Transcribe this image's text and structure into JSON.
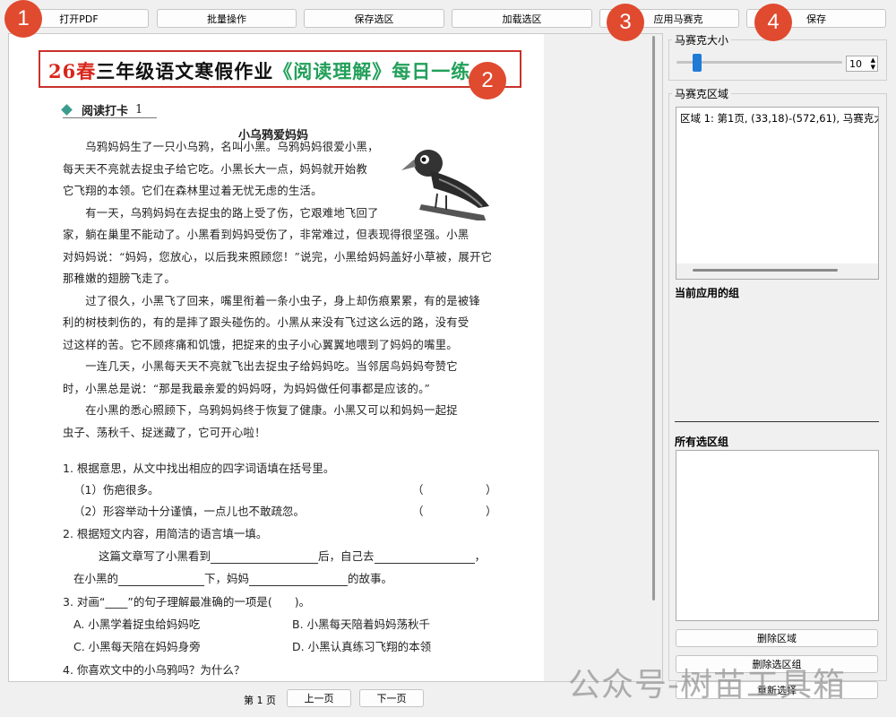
{
  "toolbar": {
    "open_pdf": "打开PDF",
    "batch": "批量操作",
    "save_selection": "保存选区",
    "load_selection": "加载选区",
    "apply_mosaic": "应用马赛克",
    "save": "保存"
  },
  "badges": [
    "1",
    "2",
    "3",
    "4"
  ],
  "document": {
    "title_red": "26春",
    "title_black": "三年级语文寒假作业",
    "title_green": "《阅读理解》每日一练",
    "section": "阅读打卡",
    "section_no": "1",
    "story_title": "小乌鸦爱妈妈",
    "paragraphs": [
      "　　乌鸦妈妈生了一只小乌鸦，名叫小黑。乌鸦妈妈很爱小黑，",
      "每天天不亮就去捉虫子给它吃。小黑长大一点，妈妈就开始教",
      "它飞翔的本领。它们在森林里过着无忧无虑的生活。",
      "　　有一天，乌鸦妈妈在去捉虫的路上受了伤，它艰难地飞回了",
      "家，躺在巢里不能动了。小黑看到妈妈受伤了，非常难过，但表现得很坚强。小黑",
      "对妈妈说：“妈妈，您放心，以后我来照顾您！”说完，小黑给妈妈盖好小草被，展开它",
      "那稚嫩的翅膀飞走了。",
      "　　过了很久，小黑飞了回来，嘴里衔着一条小虫子，身上却伤痕累累，有的是被锋",
      "利的树枝刺伤的，有的是摔了跟头碰伤的。小黑从来没有飞过这么远的路，没有受",
      "过这样的苦。它不顾疼痛和饥饿，把捉来的虫子小心翼翼地喂到了妈妈的嘴里。",
      "　　一连几天，小黑每天天不亮就飞出去捉虫子给妈妈吃。当邻居鸟妈妈夸赞它",
      "时，小黑总是说：“那是我最亲爱的妈妈呀，为妈妈做任何事都是应该的。”",
      "　　在小黑的悉心照顾下，乌鸦妈妈终于恢复了健康。小黑又可以和妈妈一起捉",
      "虫子、荡秋千、捉迷藏了，它可开心啦！"
    ],
    "q1": "1. 根据意思，从文中找出相应的四字词语填在括号里。",
    "q1_a": "（1）伤疤很多。",
    "q1_b": "（2）形容举动十分谨慎，一点儿也不敢疏忽。",
    "paren_open": "（",
    "paren_close": "）",
    "q2": "2. 根据短文内容，用简洁的语言填一填。",
    "q2_a1": "这篇文章写了小黑看到",
    "q2_a2": "后，自己去",
    "q2_a3": "，",
    "q2_b1": "在小黑的",
    "q2_b2": "下，妈妈",
    "q2_b3": "的故事。",
    "q3": "3. 对画“____”的句子理解最准确的一项是(　　)。",
    "q3_a": "A. 小黑学着捉虫给妈妈吃",
    "q3_b": "B. 小黑每天陪着妈妈荡秋千",
    "q3_c": "C. 小黑每天陪在妈妈身旁",
    "q3_d": "D. 小黑认真练习飞翔的本领",
    "q4": "4. 你喜欢文中的小乌鸦吗？为什么？"
  },
  "pager": {
    "page_prefix": "第",
    "page_no": "1",
    "page_suffix": "页",
    "prev": "上一页",
    "next": "下一页"
  },
  "panel": {
    "mosaic_size_label": "马赛克大小",
    "mosaic_size_value": "10",
    "mosaic_size_fraction": 0.1,
    "mosaic_area_label": "马赛克区域",
    "area_item": "区域 1: 第1页, (33,18)-(572,61), 马赛克大",
    "current_group_label": "当前应用的组",
    "all_groups_label": "所有选区组",
    "delete_area": "删除区域",
    "delete_group": "删除选区组",
    "reselect": "重新选择"
  },
  "watermark": "公众号-树苗工具箱",
  "colors": {
    "badge": "#e04a2f",
    "title_red": "#d8261c",
    "title_green": "#22a05a",
    "slider_thumb": "#1e7bd6"
  }
}
